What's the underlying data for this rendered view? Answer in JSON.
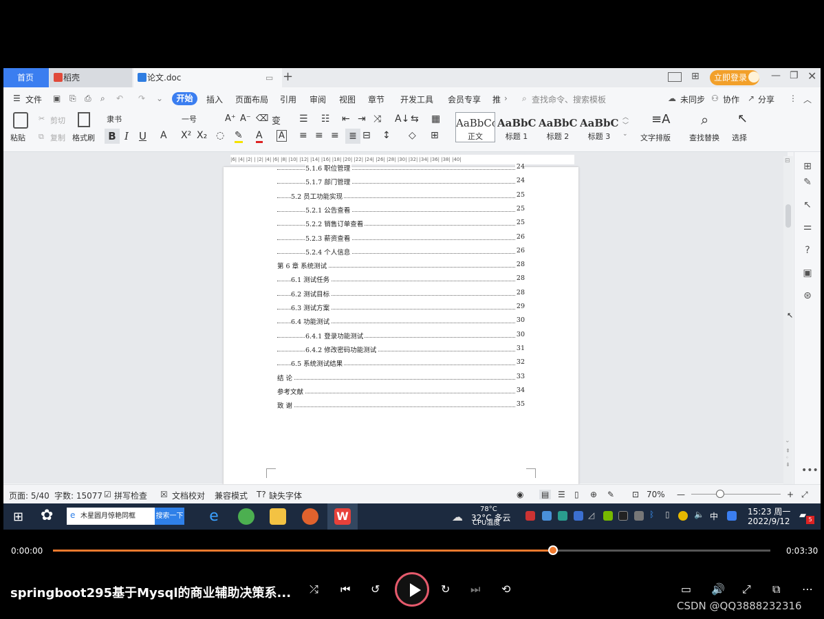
{
  "tabs": {
    "home": "首页",
    "docer": "稻壳",
    "doc": "论文.doc",
    "new_tab": "+",
    "login": "立即登录"
  },
  "menu": {
    "file": "文件",
    "items": [
      "开始",
      "插入",
      "页面布局",
      "引用",
      "审阅",
      "视图",
      "章节",
      "开发工具",
      "会员专享",
      "推"
    ],
    "search_placeholder": "查找命令、搜索模板",
    "sync": "未同步",
    "collab": "协作",
    "share": "分享"
  },
  "ribbon": {
    "paste": "粘贴",
    "cut": "剪切",
    "copy": "复制",
    "format_painter": "格式刷",
    "font_name": "隶书",
    "font_size": "一号",
    "styles": [
      {
        "sample": "AaBbCcI",
        "name": "正文"
      },
      {
        "sample": "AaBbC",
        "name": "标题 1"
      },
      {
        "sample": "AaBbC",
        "name": "标题 2"
      },
      {
        "sample": "AaBbC",
        "name": "标题 3"
      }
    ],
    "text_layout": "文字排版",
    "find_replace": "查找替换",
    "select": "选择"
  },
  "ruler": "|6| |4| |2| | |2| |4| |6| |8| |10| |12| |14| |16| |18| |20| |22| |24| |26| |28| |30| |32| |34| |36| |38| |40|",
  "toc": [
    {
      "level": 3,
      "text": "5.1.6  职位管理",
      "page": "24"
    },
    {
      "level": 3,
      "text": "5.1.7  部门管理",
      "page": "24"
    },
    {
      "level": 2,
      "text": "5.2 员工功能实现",
      "page": "25"
    },
    {
      "level": 3,
      "text": "5.2.1  公告查看",
      "page": "25"
    },
    {
      "level": 3,
      "text": "5.2.2  销售订单查看",
      "page": "25"
    },
    {
      "level": 3,
      "text": "5.2.3  薪资查看",
      "page": "26"
    },
    {
      "level": 3,
      "text": "5.2.4  个人信息",
      "page": "26"
    },
    {
      "level": 1,
      "text": "第 6 章  系统测试",
      "page": "28"
    },
    {
      "level": 2,
      "text": "6.1 测试任务",
      "page": "28"
    },
    {
      "level": 2,
      "text": "6.2 测试目标",
      "page": "28"
    },
    {
      "level": 2,
      "text": "6.3 测试方案",
      "page": "29"
    },
    {
      "level": 2,
      "text": "6.4 功能测试",
      "page": "30"
    },
    {
      "level": 3,
      "text": "6.4.1  登录功能测试",
      "page": "30"
    },
    {
      "level": 3,
      "text": "6.4.2  修改密码功能测试",
      "page": "31"
    },
    {
      "level": 2,
      "text": "6.5 系统测试结果",
      "page": "32"
    },
    {
      "level": 1,
      "text": "结    论",
      "page": "33"
    },
    {
      "level": 1,
      "text": "参考文献",
      "page": "34"
    },
    {
      "level": 1,
      "text": "致    谢",
      "page": "35"
    }
  ],
  "status": {
    "page": "页面: 5/40",
    "words": "字数: 15077",
    "spell": "拼写检查",
    "proof": "文档校对",
    "compat": "兼容模式",
    "missing_font": "缺失字体",
    "zoom": "70%"
  },
  "taskbar": {
    "search_text": "木星圆月惊艳同框",
    "search_btn": "搜索一下",
    "weather": "32°C  多云",
    "cpu_temp": "78°C",
    "cpu_label": "CPU温度",
    "ime": "中",
    "time": "15:23 周一",
    "date": "2022/9/12",
    "badge": "5"
  },
  "player": {
    "elapsed": "0:00:00",
    "duration": "0:03:30",
    "progress": 0.697,
    "title": "springboot295基于Mysql的商业辅助决策系...",
    "watermark": "CSDN @QQ3888232316"
  },
  "colors": {
    "accent": "#3b7ef0",
    "login": "#f2a02a",
    "progress": "#f07a2e",
    "taskbar": "#1c2a3f"
  }
}
